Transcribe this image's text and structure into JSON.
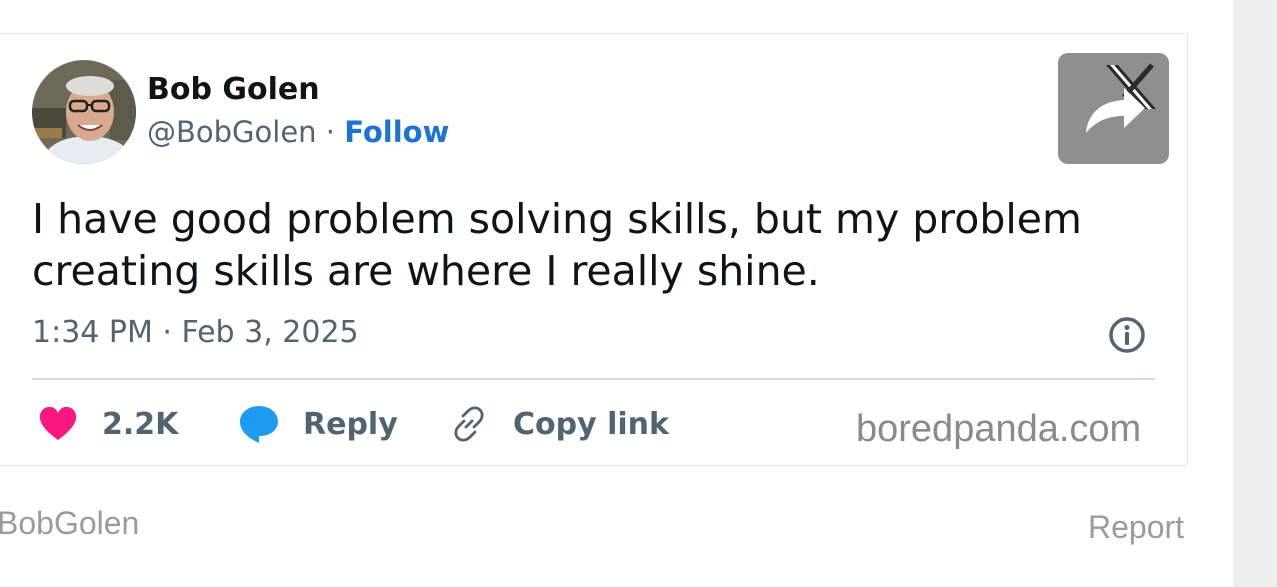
{
  "tweet": {
    "author": {
      "name": "Bob Golen",
      "handle": "@BobGolen",
      "separator": " · ",
      "follow_label": "Follow"
    },
    "text": "I have good problem solving skills, but my problem creating skills are where I really shine.",
    "timestamp": "1:34 PM · Feb 3, 2025",
    "actions": {
      "likes_count": "2.2K",
      "reply_label": "Reply",
      "copy_link_label": "Copy link"
    },
    "watermark": "boredpanda.com"
  },
  "footer": {
    "source_label": "BobGolen",
    "report_label": "Report"
  },
  "colors": {
    "like": "#f91880",
    "reply": "#1d9bf0",
    "follow": "#1d72d8",
    "muted": "#536471",
    "share_tile": "#8f8f8f"
  },
  "icons": {
    "share": "share-arrow-icon",
    "platform": "x-logo-icon",
    "info": "info-icon",
    "like": "heart-icon",
    "reply": "speech-bubble-icon",
    "copy_link": "link-icon"
  }
}
